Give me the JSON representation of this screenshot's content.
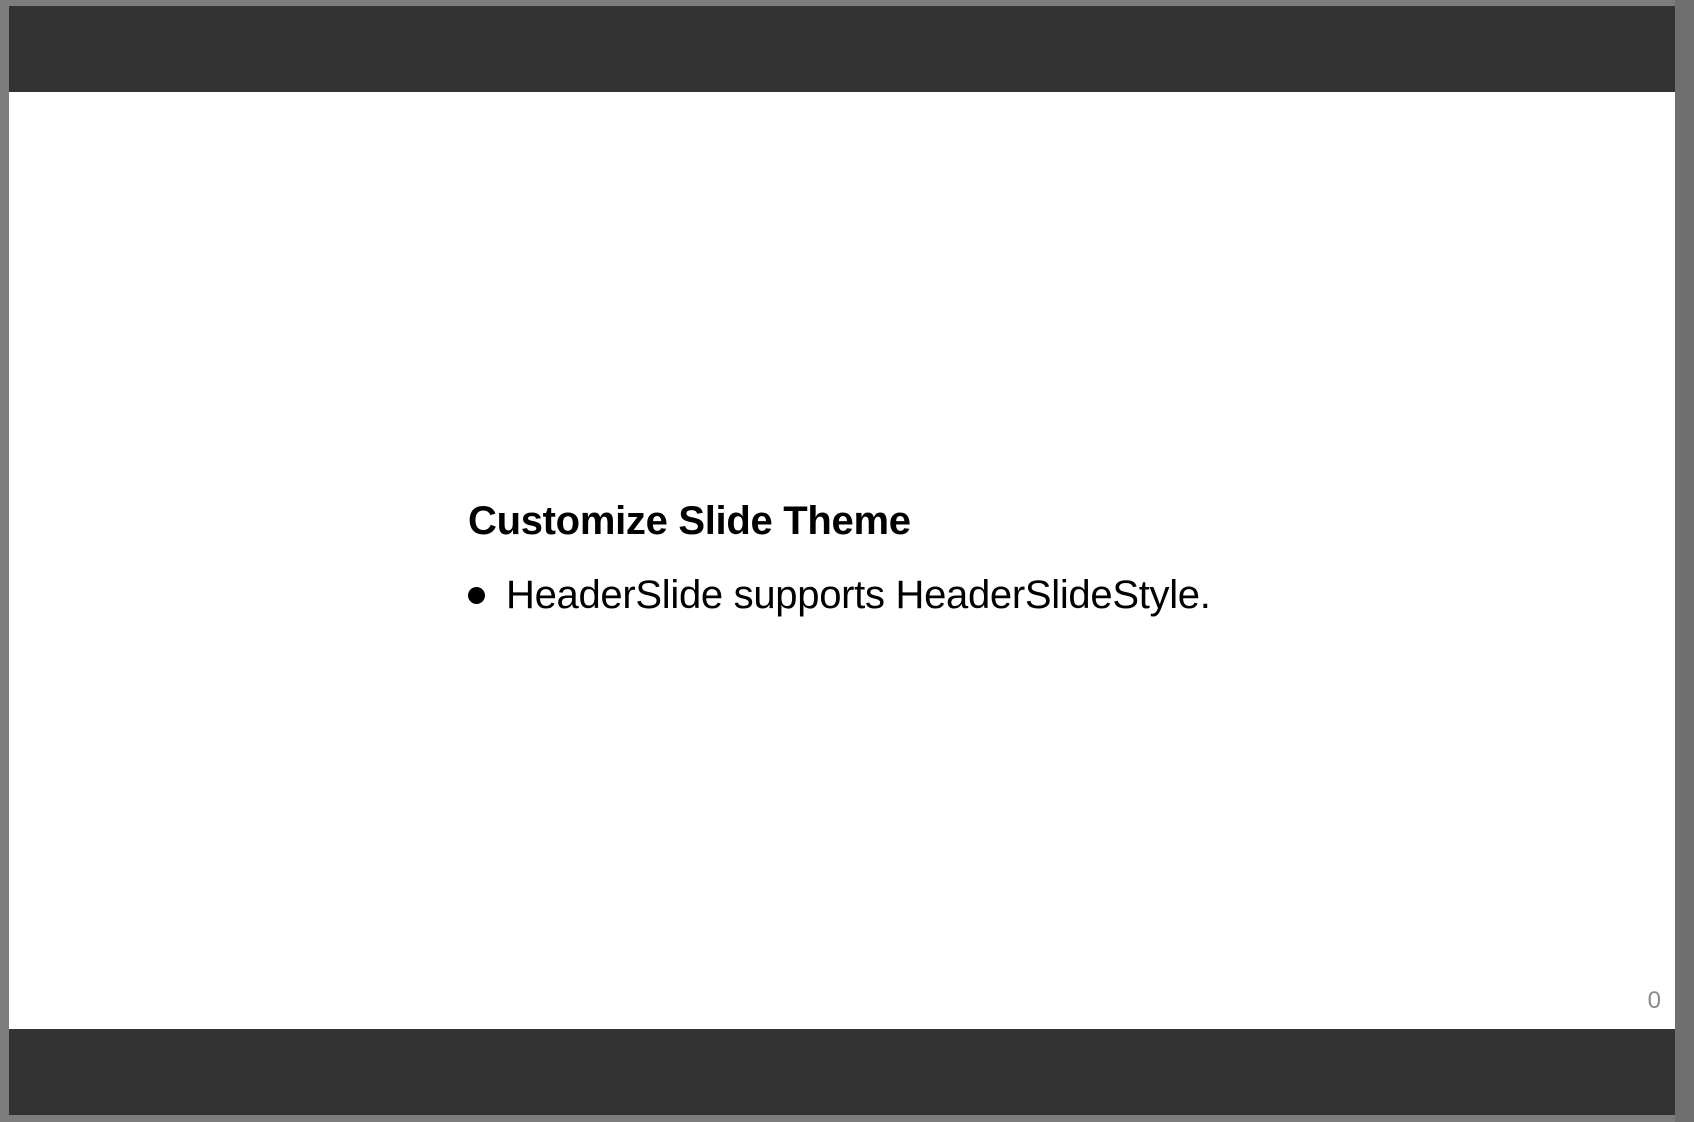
{
  "slide": {
    "title": "Customize Slide Theme",
    "bullets": [
      "HeaderSlide supports HeaderSlideStyle."
    ],
    "page_number": "0"
  },
  "colors": {
    "header_bar": "#333333",
    "footer_bar": "#333333",
    "slide_background": "#ffffff",
    "text": "#000000",
    "page_number": "#8a8a8a"
  }
}
